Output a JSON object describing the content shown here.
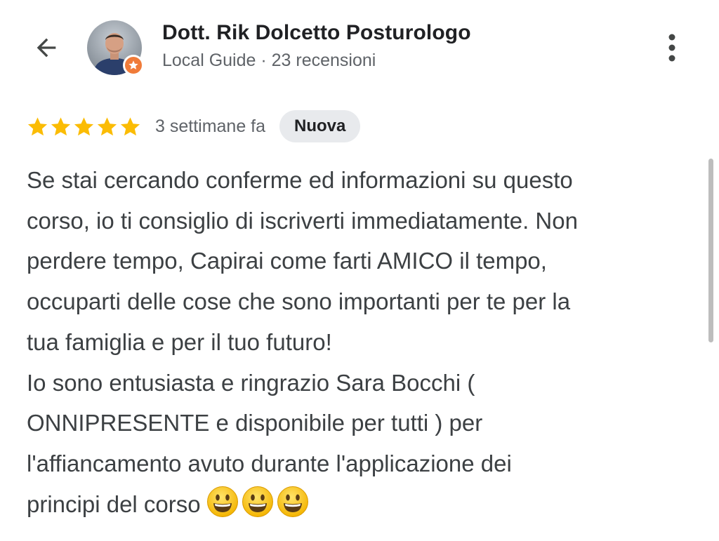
{
  "header": {
    "reviewer_name": "Dott. Rik Dolcetto Posturologo",
    "reviewer_meta": "Local Guide · 23 recensioni",
    "back_icon": "arrow-back-icon",
    "more_icon": "more-vert-icon",
    "badge_icon": "local-guide-star-icon"
  },
  "review": {
    "rating": 5,
    "rating_max": 5,
    "time_ago": "3 settimane fa",
    "badge": "Nuova",
    "lines": [
      "Se stai cercando conferme ed informazioni su questo",
      "corso, io ti consiglio di iscriverti immediatamente. Non",
      "perdere tempo, Capirai come farti AMICO il tempo,",
      "occuparti delle cose che sono importanti per te per la",
      "tua famiglia e per il tuo futuro!",
      "Io sono entusiasta e ringrazio Sara Bocchi (",
      "ONNIPRESENTE e disponibile per tutti ) per",
      "l'affiancamento avuto durante l'applicazione dei",
      "principi del corso"
    ],
    "emojis": [
      "grinning-face-icon",
      "grinning-face-icon",
      "grinning-face-icon"
    ]
  },
  "colors": {
    "star": "#fbbc04",
    "text_primary": "#202124",
    "text_body": "#3c4043",
    "text_secondary": "#5f6368",
    "badge_bg": "#e8eaed",
    "guide_badge": "#f07b39"
  }
}
